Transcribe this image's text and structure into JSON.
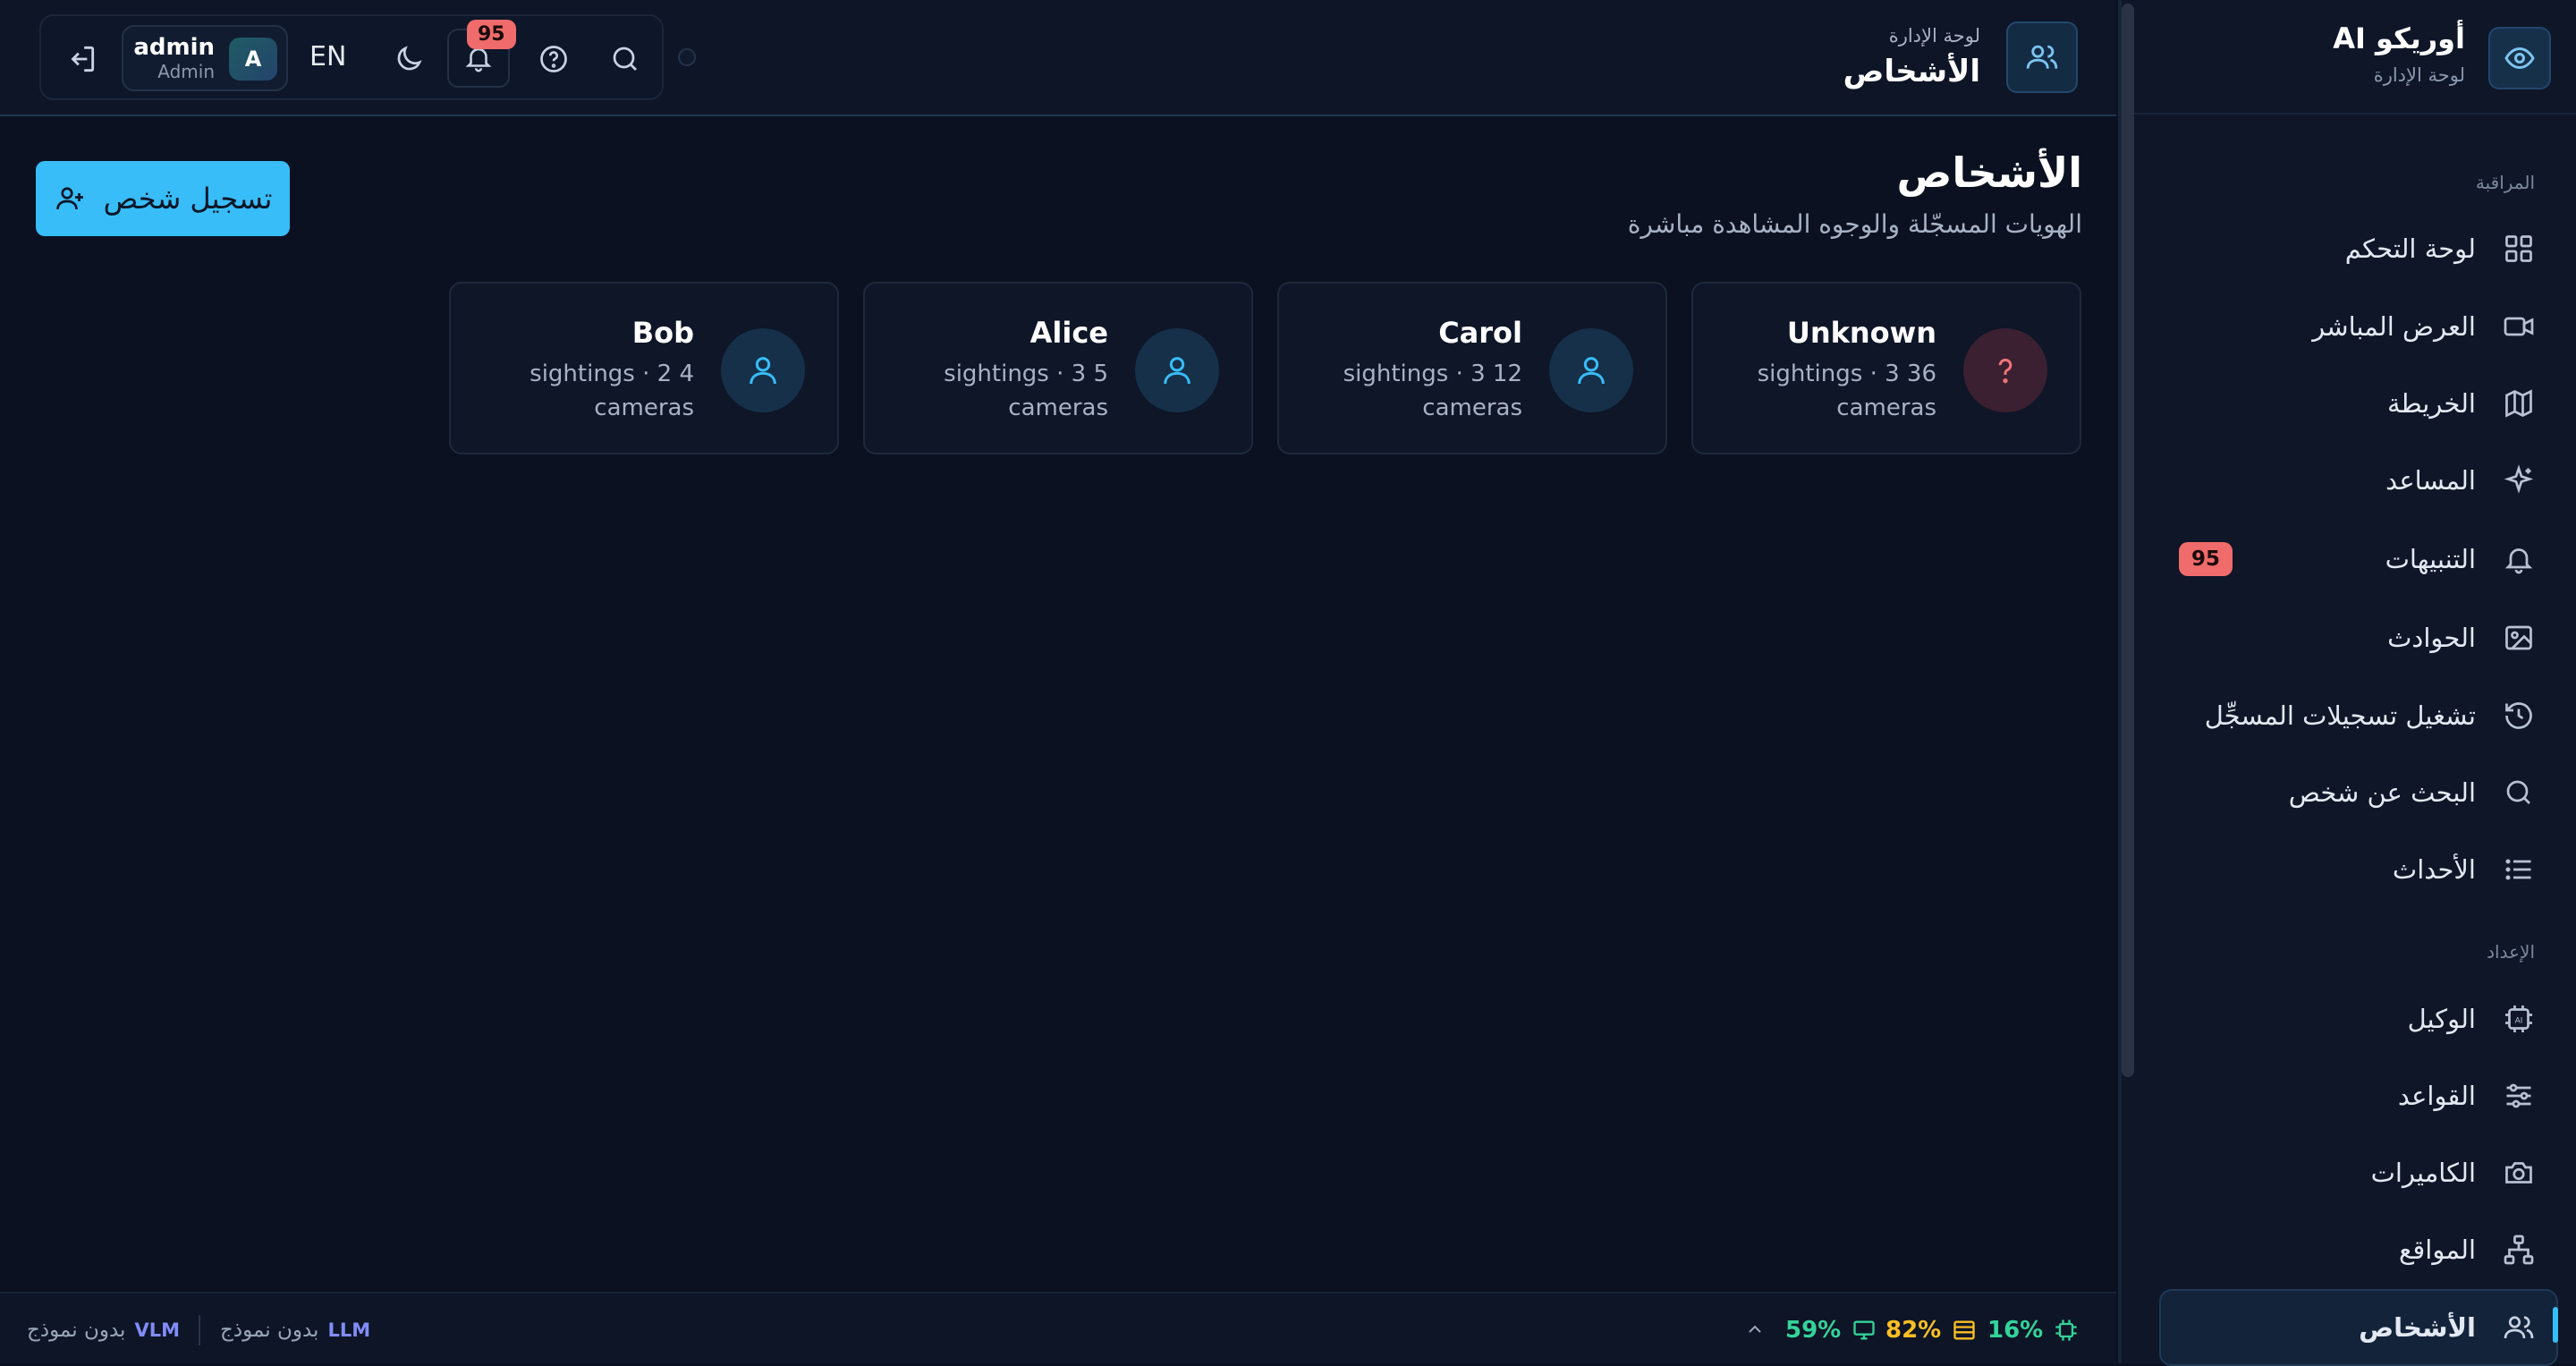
{
  "brand": {
    "title": "أوريكو AI",
    "subtitle": "لوحة الإدارة",
    "icon": "eye-icon"
  },
  "sidebar": {
    "sections": [
      {
        "label": "المراقبة"
      },
      {
        "label": "الإعداد"
      }
    ],
    "items": [
      {
        "label": "لوحة التحكم",
        "icon": "grid-icon"
      },
      {
        "label": "العرض المباشر",
        "icon": "video-icon"
      },
      {
        "label": "الخريطة",
        "icon": "map-icon"
      },
      {
        "label": "المساعد",
        "icon": "sparkles-icon"
      },
      {
        "label": "التنبيهات",
        "icon": "bell-icon",
        "badge": "95"
      },
      {
        "label": "الحوادث",
        "icon": "image-icon"
      },
      {
        "label": "تشغيل تسجيلات المسجِّل",
        "icon": "history-icon"
      },
      {
        "label": "البحث عن شخص",
        "icon": "search-icon"
      },
      {
        "label": "الأحداث",
        "icon": "list-icon"
      },
      {
        "label": "الوكيل",
        "icon": "cpu-ai-icon"
      },
      {
        "label": "القواعد",
        "icon": "sliders-icon"
      },
      {
        "label": "الكاميرات",
        "icon": "camera-icon"
      },
      {
        "label": "المواقع",
        "icon": "network-icon"
      },
      {
        "label": "الأشخاص",
        "icon": "users-icon",
        "active": true
      }
    ]
  },
  "topbar": {
    "breadcrumb": "لوحة الإدارة",
    "title": "الأشخاص",
    "user": {
      "name": "admin",
      "role": "Admin",
      "initial": "A"
    },
    "language": "EN",
    "notifications_count": "95"
  },
  "main": {
    "heading": "الأشخاص",
    "subheading": "الهويات المسجّلة والوجوه المشاهدة مباشرة",
    "register_button": "تسجيل شخص",
    "people": [
      {
        "name": "Unknown",
        "line1": "sightings · 3 36",
        "line2": "cameras",
        "icon": "question-icon",
        "unknown": true
      },
      {
        "name": "Carol",
        "line1": "sightings · 3 12",
        "line2": "cameras",
        "icon": "user-icon"
      },
      {
        "name": "Alice",
        "line1": "sightings · 3 5",
        "line2": "cameras",
        "icon": "user-icon"
      },
      {
        "name": "Bob",
        "line1": "sightings · 2 4",
        "line2": "cameras",
        "icon": "user-icon"
      }
    ]
  },
  "footer": {
    "vlm": {
      "tag": "VLM",
      "text": "بدون نموذج"
    },
    "llm": {
      "tag": "LLM",
      "text": "بدون نموذج"
    },
    "stats": [
      {
        "value": "59%",
        "icon": "monitor-icon",
        "color": "#34d399"
      },
      {
        "value": "82%",
        "icon": "storage-icon",
        "color": "#fbbf24"
      },
      {
        "value": "16%",
        "icon": "cpu-icon",
        "color": "#34d399"
      }
    ]
  },
  "colors": {
    "accent": "#38bdf8",
    "badge": "#f06b6b",
    "background": "#0b1120",
    "surface": "#0e1628"
  }
}
